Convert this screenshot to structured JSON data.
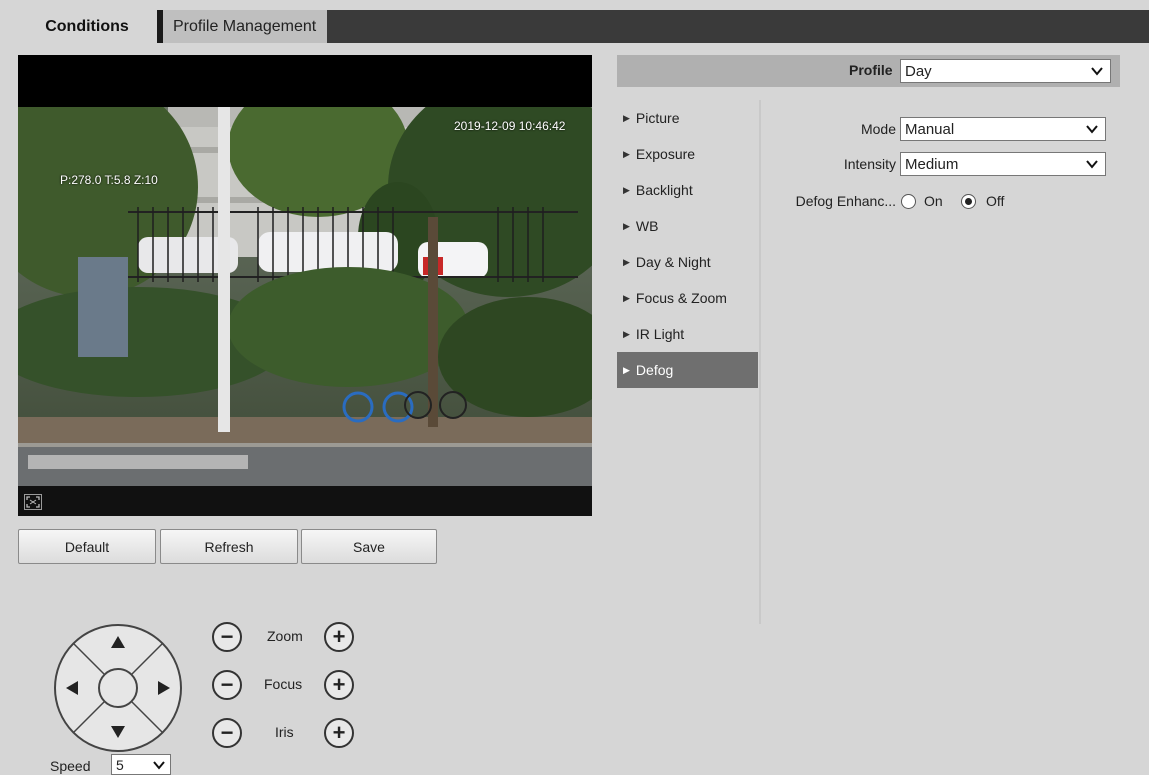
{
  "tabs": {
    "active": "Conditions",
    "inactive": "Profile Management"
  },
  "video": {
    "timestamp": "2019-12-09 10:46:42",
    "ptz_osd": "P:278.0 T:5.8 Z:10"
  },
  "actions": {
    "default_label": "Default",
    "refresh_label": "Refresh",
    "save_label": "Save"
  },
  "ptz": {
    "zoom_label": "Zoom",
    "focus_label": "Focus",
    "iris_label": "Iris",
    "minus": "−",
    "plus": "+",
    "speed_label": "Speed",
    "speed_value": "5"
  },
  "profile": {
    "label": "Profile",
    "value": "Day"
  },
  "menu": {
    "items": [
      "Picture",
      "Exposure",
      "Backlight",
      "WB",
      "Day & Night",
      "Focus & Zoom",
      "IR Light",
      "Defog"
    ],
    "active": "Defog"
  },
  "defog": {
    "mode_label": "Mode",
    "mode_value": "Manual",
    "intensity_label": "Intensity",
    "intensity_value": "Medium",
    "enhance_label": "Defog Enhanc...",
    "on_label": "On",
    "off_label": "Off",
    "selected": "Off"
  },
  "colors": {
    "background": "#d6d6d6",
    "tab_bar": "#3a3a3a",
    "active_menu": "#6f6f6f",
    "profile_bar": "#b0b0b0"
  }
}
